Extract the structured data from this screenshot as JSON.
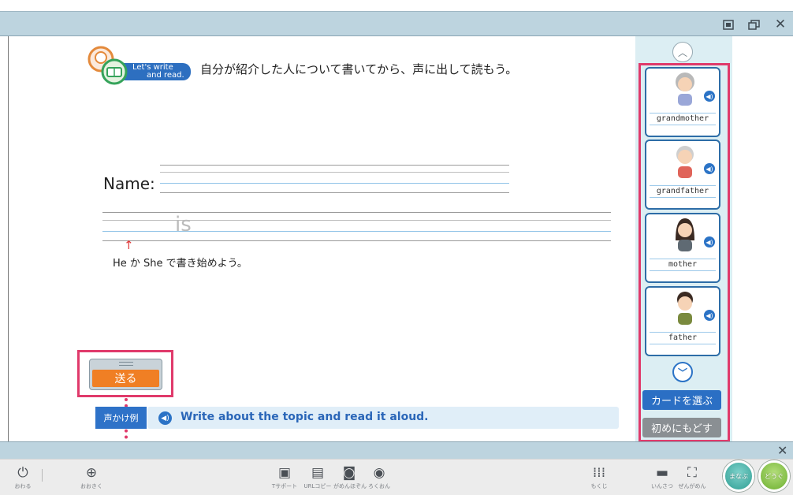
{
  "window": {
    "controls": [
      "restore-icon",
      "maximize-icon",
      "close-icon"
    ]
  },
  "header": {
    "badge_line1": "Let's write",
    "badge_line2": "and read.",
    "instruction": "自分が紹介した人について書いてから、声に出して読もう。"
  },
  "worksheet": {
    "name_label": "Name:",
    "sentence_word": "is",
    "hint": "He か She で書き始めよう。"
  },
  "send_button": {
    "label": "送る"
  },
  "voice_example": {
    "badge": "声かけ例",
    "text": "Write about the topic and read it aloud."
  },
  "cards": [
    {
      "label": "grandmother",
      "icon": "grandmother-icon"
    },
    {
      "label": "grandfather",
      "icon": "grandfather-icon"
    },
    {
      "label": "mother",
      "icon": "mother-icon"
    },
    {
      "label": "father",
      "icon": "father-icon"
    }
  ],
  "side_buttons": {
    "choose_card": "カードを選ぶ",
    "reset": "初めにもどす"
  },
  "toolbar": {
    "end": "おわる",
    "zoom": "おおきく",
    "t_support": "Tサポート",
    "url_copy": "URLコピー",
    "screenshot": "がめんほぞん",
    "record": "ろくおん",
    "contents": "もくじ",
    "print": "いんさつ",
    "full_screen": "ぜんがめん",
    "learn": "まなぶ",
    "tools": "どうぐ"
  },
  "colors": {
    "accent_blue": "#2d6fc0",
    "highlight_red": "#e03a6b",
    "send_orange": "#f07f24",
    "panel_bg": "#dceef3"
  }
}
